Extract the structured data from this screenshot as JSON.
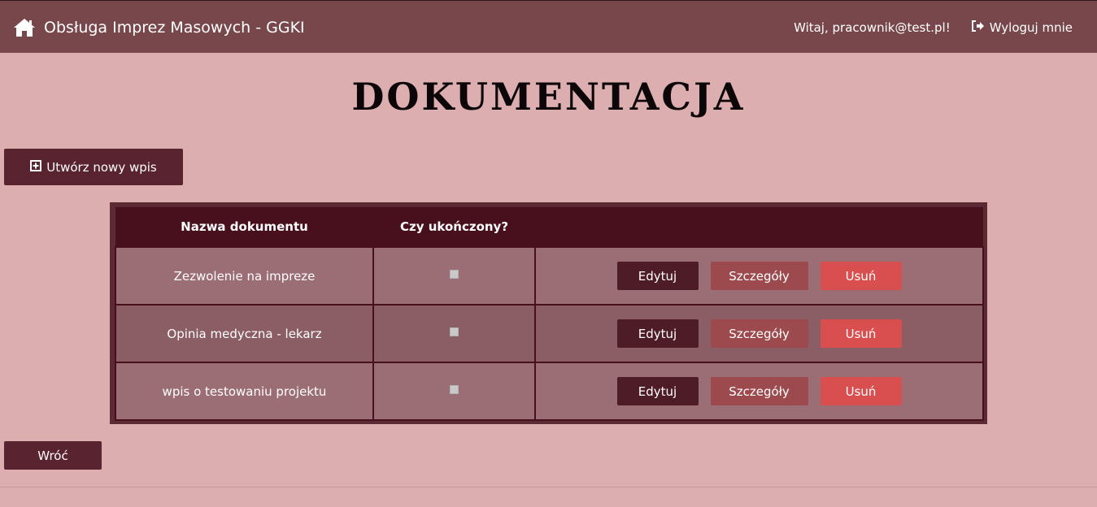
{
  "navbar": {
    "brand_icon": "home-icon",
    "brand_title": "Obsługa Imprez Masowych - GGKI",
    "greeting": "Witaj, pracownik@test.pl!",
    "logout_icon": "sign-out-icon",
    "logout_label": "Wyloguj mnie"
  },
  "page": {
    "title": "DOKUMENTACJA",
    "create_icon": "plus-square-icon",
    "create_label": "Utwórz nowy wpis",
    "back_label": "Wróć"
  },
  "table": {
    "columns": [
      "Nazwa dokumentu",
      "Czy ukończony?",
      ""
    ],
    "rows": [
      {
        "name": "Zezwolenie na impreze",
        "completed": false
      },
      {
        "name": "Opinia medyczna - lekarz",
        "completed": false
      },
      {
        "name": "wpis o testowaniu projektu",
        "completed": false
      }
    ],
    "actions": {
      "edit": "Edytuj",
      "details": "Szczegóły",
      "delete": "Usuń"
    }
  },
  "colors": {
    "navbar": "#77474b",
    "background": "#dcaeb0",
    "header": "#48101c",
    "edit": "#4e1c27",
    "details": "#9c4a4e",
    "delete": "#d94f4f"
  }
}
